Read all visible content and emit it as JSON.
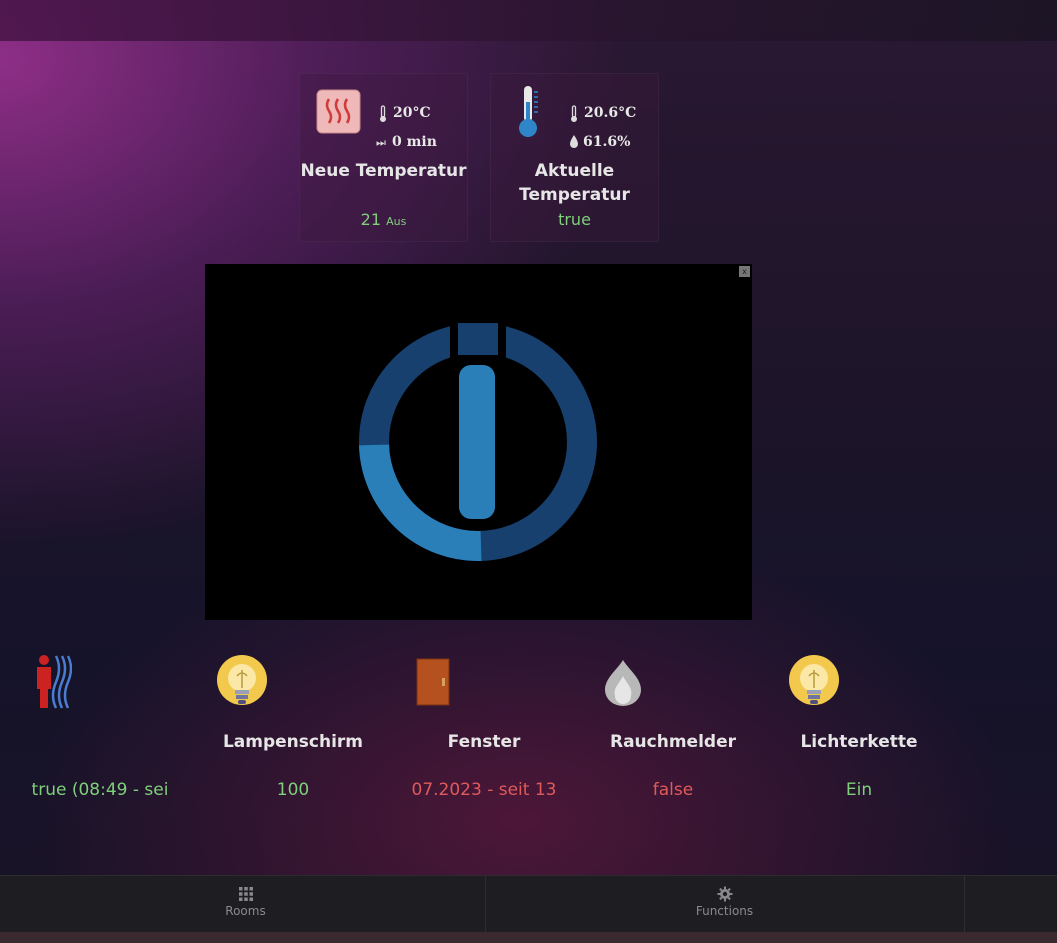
{
  "accent_green": "#7ed07a",
  "accent_red": "#e05a5a",
  "thermostat_card": {
    "set_temp": "20°C",
    "boost": "0 min",
    "title": "Neue Temperatur",
    "value": "21",
    "value_suffix": "Aus",
    "icon": "heater-icon"
  },
  "climate_card": {
    "temperature": "20.6°C",
    "humidity": "61.6%",
    "title": "Aktuelle Temperatur",
    "value": "true",
    "icon": "thermometer-icon"
  },
  "video": {
    "close_label": "x",
    "logo": "iobroker-logo"
  },
  "devices": [
    {
      "label": "",
      "value": "true (08:49 - sei",
      "status": "green",
      "icon": "motion-sensor-icon"
    },
    {
      "label": "Lampenschirm",
      "value": "100",
      "status": "green",
      "icon": "bulb-icon"
    },
    {
      "label": "Fenster",
      "value": "07.2023 - seit 13",
      "status": "red",
      "icon": "door-icon"
    },
    {
      "label": "Rauchmelder",
      "value": "false",
      "status": "red",
      "icon": "fire-icon"
    },
    {
      "label": "Lichterkette",
      "value": "Ein",
      "status": "green",
      "icon": "bulb-icon"
    }
  ],
  "nav": [
    {
      "label": "Rooms",
      "icon": "grid-icon"
    },
    {
      "label": "Functions",
      "icon": "gear-icon"
    }
  ]
}
